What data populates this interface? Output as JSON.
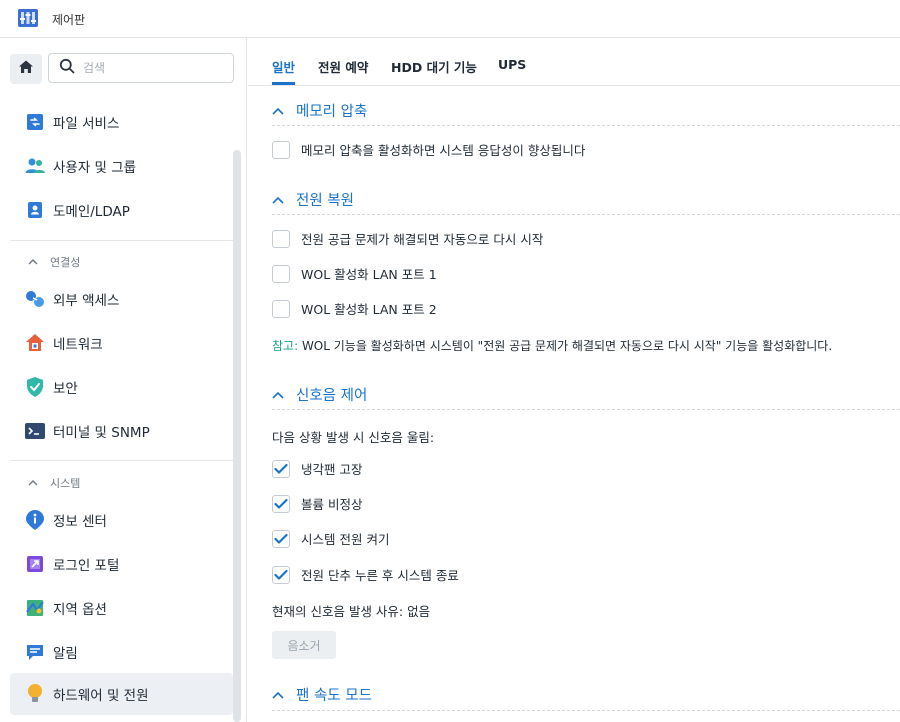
{
  "window": {
    "title": "제어판"
  },
  "sidebar": {
    "search_placeholder": "검색",
    "items_top": [
      {
        "label": "파일 서비스"
      },
      {
        "label": "사용자 및 그룹"
      },
      {
        "label": "도메인/LDAP"
      }
    ],
    "group_connectivity": "연결성",
    "items_connectivity": [
      {
        "label": "외부 액세스"
      },
      {
        "label": "네트워크"
      },
      {
        "label": "보안"
      },
      {
        "label": "터미널 및 SNMP"
      }
    ],
    "group_system": "시스템",
    "items_system": [
      {
        "label": "정보 센터"
      },
      {
        "label": "로그인 포털"
      },
      {
        "label": "지역 옵션"
      },
      {
        "label": "알림"
      },
      {
        "label": "하드웨어 및 전원"
      }
    ]
  },
  "tabs": [
    {
      "label": "일반",
      "active": true
    },
    {
      "label": "전원 예약"
    },
    {
      "label": "HDD 대기 기능"
    },
    {
      "label": "UPS"
    }
  ],
  "sections": {
    "memory": {
      "title": "메모리 압축",
      "option": "메모리 압축을 활성화하면 시스템 응답성이 향상됩니다",
      "checked": false
    },
    "power_recovery": {
      "title": "전원 복원",
      "options": [
        {
          "label": "전원 공급 문제가 해결되면 자동으로 다시 시작",
          "checked": false
        },
        {
          "label": "WOL 활성화 LAN 포트 1",
          "checked": false
        },
        {
          "label": "WOL 활성화 LAN 포트 2",
          "checked": false
        }
      ],
      "note_label": "참고:",
      "note_text": " WOL 기능을 활성화하면 시스템이 \"전원 공급 문제가 해결되면 자동으로 다시 시작\" 기능을 활성화합니다."
    },
    "beep": {
      "title": "신호음 제어",
      "intro": "다음 상황 발생 시 신호음 울림:",
      "options": [
        {
          "label": "냉각팬 고장",
          "checked": true
        },
        {
          "label": "볼륨 비정상",
          "checked": true
        },
        {
          "label": "시스템 전원 켜기",
          "checked": true
        },
        {
          "label": "전원 단추 누른 후 시스템 종료",
          "checked": true
        }
      ],
      "status": "현재의 신호음 발생 사유: 없음",
      "mute_label": "음소거"
    },
    "fan": {
      "title": "팬 속도 모드"
    }
  },
  "colors": {
    "accent": "#1a73c8",
    "note": "#18a38a"
  }
}
